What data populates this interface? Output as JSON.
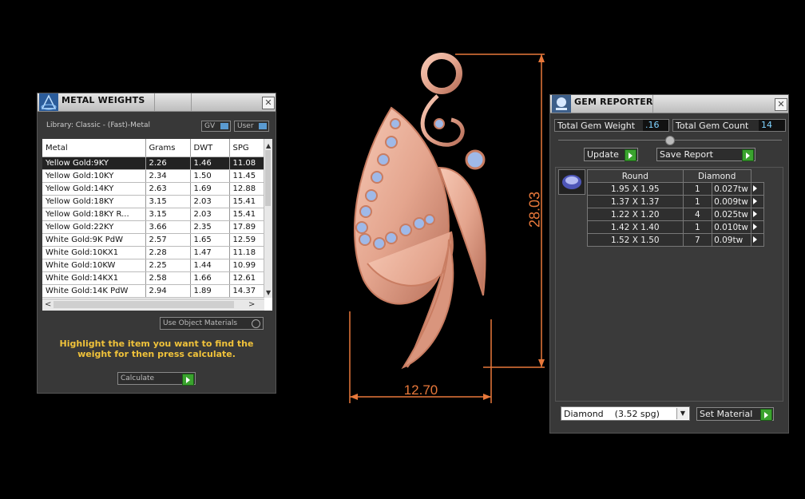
{
  "metal_weights": {
    "title": "METAL WEIGHTS",
    "library": "Library: Classic - (Fast)-Metal",
    "toggle_gv": "GV",
    "toggle_user": "User",
    "columns": [
      "Metal",
      "Grams",
      "DWT",
      "SPG"
    ],
    "rows": [
      [
        "Yellow Gold:9KY",
        "2.26",
        "1.46",
        "11.08"
      ],
      [
        "Yellow Gold:10KY",
        "2.34",
        "1.50",
        "11.45"
      ],
      [
        "Yellow Gold:14KY",
        "2.63",
        "1.69",
        "12.88"
      ],
      [
        "Yellow Gold:18KY",
        "3.15",
        "2.03",
        "15.41"
      ],
      [
        "Yellow Gold:18KY R...",
        "3.15",
        "2.03",
        "15.41"
      ],
      [
        "Yellow Gold:22KY",
        "3.66",
        "2.35",
        "17.89"
      ],
      [
        "White Gold:9K PdW",
        "2.57",
        "1.65",
        "12.59"
      ],
      [
        "White Gold:10KX1",
        "2.28",
        "1.47",
        "11.18"
      ],
      [
        "White Gold:10KW",
        "2.25",
        "1.44",
        "10.99"
      ],
      [
        "White Gold:14KX1",
        "2.58",
        "1.66",
        "12.61"
      ],
      [
        "White Gold:14K PdW",
        "2.94",
        "1.89",
        "14.37"
      ]
    ],
    "use_object_materials": "Use Object Materials",
    "hint": "Highlight the item you want to find the weight for then press calculate.",
    "calculate_label": "Calculate"
  },
  "dimensions": {
    "height": "28.03",
    "width": "12.70"
  },
  "gem_reporter": {
    "title": "GEM REPORTER",
    "total_weight_label": "Total Gem Weight",
    "total_weight_value": ".16",
    "total_count_label": "Total Gem Count",
    "total_count_value": "14",
    "update_label": "Update",
    "save_report_label": "Save Report",
    "columns": [
      "Round",
      "",
      "Diamond"
    ],
    "rows": [
      [
        "1.95 X 1.95",
        "1",
        "0.027tw"
      ],
      [
        "1.37 X 1.37",
        "1",
        "0.009tw"
      ],
      [
        "1.22 X 1.20",
        "4",
        "0.025tw"
      ],
      [
        "1.42 X 1.40",
        "1",
        "0.010tw"
      ],
      [
        "1.52 X 1.50",
        "7",
        "0.09tw"
      ]
    ],
    "material_select": "Diamond    (3.52 spg)",
    "set_material_label": "Set Material"
  },
  "colors": {
    "dimension_line": "#e8783a",
    "rose_gold": "#e4a58e",
    "gem": "#9fb9e8",
    "hint_text": "#f0c23a",
    "accent_green": "#3aa32e"
  }
}
